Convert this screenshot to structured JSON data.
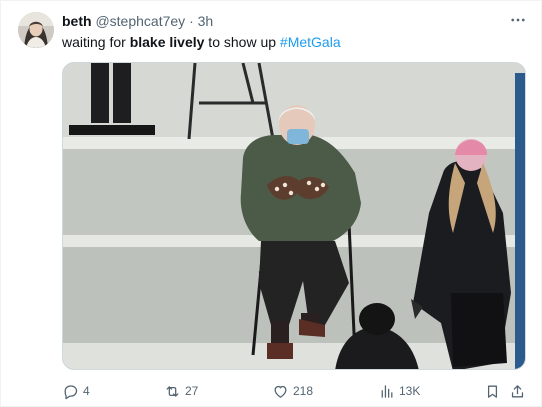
{
  "tweet": {
    "author_name": "beth",
    "author_handle": "@stephcat7ey",
    "separator": "·",
    "time": "3h",
    "text_before": "waiting for ",
    "text_bold": "blake lively",
    "text_after": " to show up ",
    "hashtag": "#MetGala"
  },
  "icons": {
    "more": "more-dots-icon",
    "reply": "reply-bubble-icon",
    "retweet": "retweet-arrows-icon",
    "like": "heart-icon",
    "views": "bar-chart-icon",
    "bookmark": "bookmark-icon",
    "share": "share-upload-icon"
  },
  "actions": {
    "replies": "4",
    "retweets": "27",
    "likes": "218",
    "views": "13K"
  },
  "colors": {
    "text": "#0f1419",
    "secondary": "#536471",
    "accent": "#1d9bf0",
    "border": "#cfd9de"
  }
}
